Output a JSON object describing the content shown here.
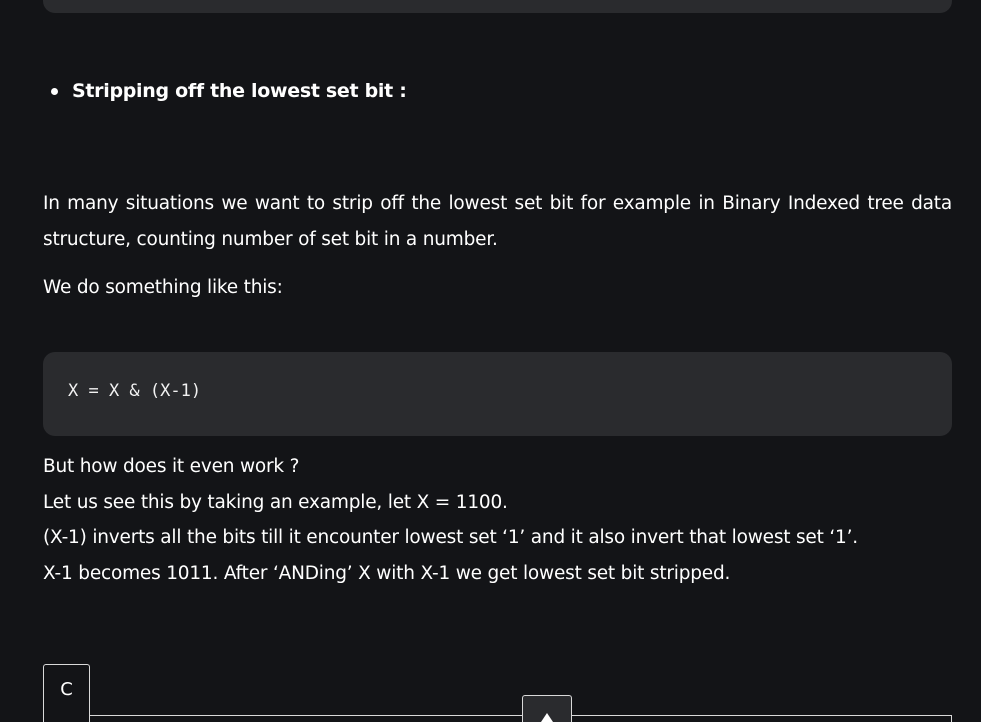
{
  "section": {
    "bullet_heading": "Stripping off the lowest set bit :"
  },
  "article": {
    "intro_paragraph": "In many situations we want to strip off the lowest set bit for example in Binary Indexed tree data structure, counting number of set bit in a number.",
    "lead_in": "We do something like this:",
    "code_snippet": "X = X & (X-1)",
    "explanation": [
      "But how does it even work ?",
      "Let us see this by taking an example, let X = 1100.",
      "(X-1)  inverts all the bits till it encounter lowest set ‘1’ and it also invert that lowest set ‘1’.",
      "X-1 becomes 1011. After ‘ANDing’ X with X-1 we get lowest set bit stripped."
    ]
  },
  "code_tabs": {
    "active_language": "C"
  },
  "controls": {
    "scroll_top_icon": "caret-up-icon"
  },
  "colors": {
    "background": "#131417",
    "code_background": "#2a2b2e",
    "text": "#ffffff",
    "tab_border": "#d9d9d9"
  }
}
